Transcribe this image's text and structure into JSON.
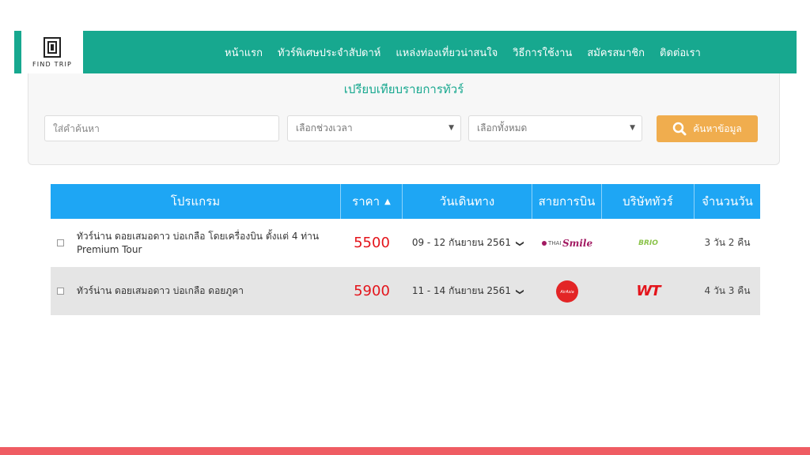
{
  "brand": {
    "name": "FIND TRIP"
  },
  "nav": {
    "items": [
      {
        "label": "หน้าแรก"
      },
      {
        "label": "ทัวร์พิเศษประจำสัปดาห์"
      },
      {
        "label": "แหล่งท่องเที่ยวน่าสนใจ"
      },
      {
        "label": "วิธีการใช้งาน"
      },
      {
        "label": "สมัครสมาชิก"
      },
      {
        "label": "ติดต่อเรา"
      }
    ]
  },
  "search": {
    "title": "เปรียบเทียบรายการทัวร์",
    "keyword_placeholder": "ใส่คำค้นหา",
    "period_value": "เลือกช่วงเวลา",
    "category_value": "เลือกทั้งหมด",
    "button_label": "ค้นหาข้อมูล",
    "button_color": "#f0ad4e"
  },
  "table": {
    "headers": {
      "program": "โปรแกรม",
      "price": "ราคา",
      "date": "วันเดินทาง",
      "airline": "สายการบิน",
      "company": "บริษัททัวร์",
      "days": "จำนวนวัน"
    },
    "header_color": "#1ea6f4",
    "price_color": "#e4141b",
    "rows": [
      {
        "program": "ทัวร์น่าน ดอยเสมอดาว บ่อเกลือ โดยเครื่องบิน ตั้งแต่ 4 ท่าน Premium Tour",
        "price": "5500",
        "date": "09 - 12 กันยายน 2561",
        "airline_logo": {
          "thai": "THAI",
          "smile": "Smile"
        },
        "company_logo": "BRIO",
        "days": "3 วัน 2 คืน"
      },
      {
        "program": "ทัวร์น่าน ดอยเสมอดาว บ่อเกลือ ดอยภูคา",
        "price": "5900",
        "date": "11 - 14 กันยายน 2561",
        "airline_logo": {
          "text": "AirAsia"
        },
        "company_logo": "WT",
        "days": "4 วัน 3 คืน"
      }
    ]
  },
  "colors": {
    "primary": "#17a88f",
    "accent_bar": "#ef5c63"
  }
}
